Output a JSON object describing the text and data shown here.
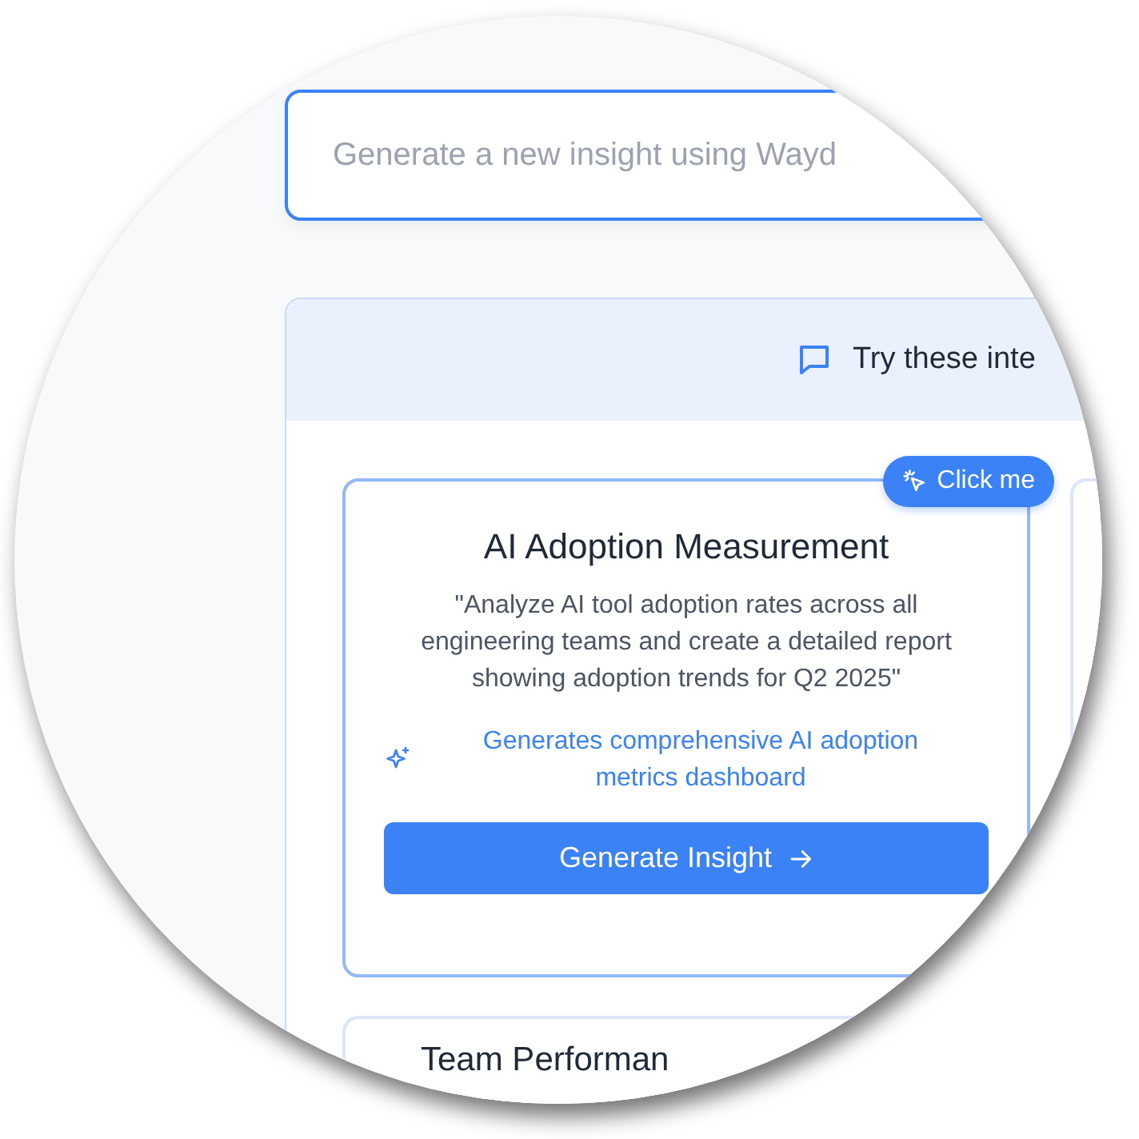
{
  "input": {
    "placeholder": "Generate a new insight using Wayd"
  },
  "suggestions": {
    "header": "Try these inte",
    "cards": [
      {
        "kind": "full",
        "title": "AI Adoption Measurement",
        "badge": "Click me",
        "prompt": "\"Analyze AI tool adoption rates across all engineering teams and create a detailed report showing adoption trends for Q2 2025\"",
        "outcome": "Generates comprehensive AI adoption metrics dashboard",
        "button": "Generate Insight"
      },
      {
        "kind": "partial"
      },
      {
        "kind": "partial",
        "title": "Team Performan"
      }
    ]
  }
}
